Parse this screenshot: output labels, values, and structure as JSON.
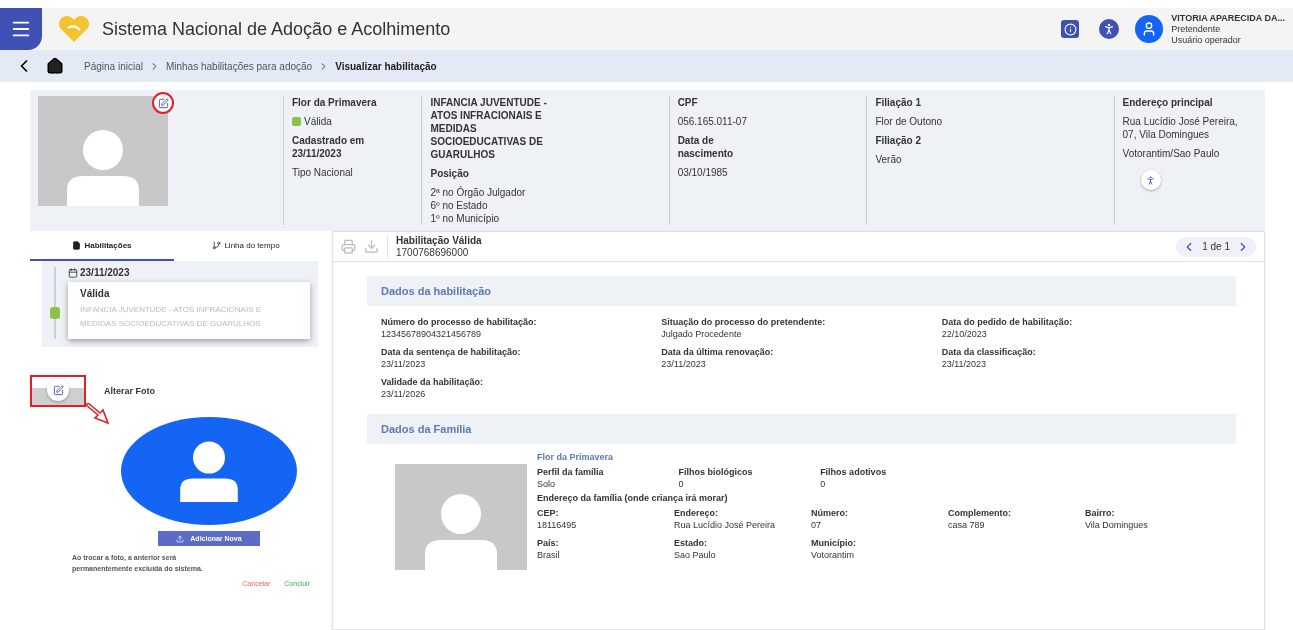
{
  "header": {
    "title": "Sistema Nacional de Adoção e Acolhimento",
    "user": {
      "name": "VITORIA APARECIDA DA...",
      "role": "Pretendente",
      "profile": "Usuário operador"
    }
  },
  "breadcrumb": [
    {
      "label": "Página inicial",
      "current": false
    },
    {
      "label": "Minhas habilitações para adoção",
      "current": false
    },
    {
      "label": "Visualizar habilitação",
      "current": true
    }
  ],
  "summary": {
    "name": "Flor da Primavera",
    "status": {
      "label": "Válida",
      "color": "#8bc34a"
    },
    "registered": "Cadastrado em 23/11/2023",
    "type": "Tipo Nacional",
    "court": "INFANCIA JUVENTUDE - ATOS INFRACIONAIS E MEDIDAS SOCIOEDUCATIVAS DE GUARULHOS",
    "position_label": "Posição",
    "positions": [
      "2ª no Órgão Julgador",
      "6º no Estado",
      "1º no Município"
    ],
    "columns": [
      {
        "items": [
          {
            "label": "CPF",
            "values": [
              "056.165.011-07"
            ]
          },
          {
            "label": "Data de nascimento",
            "values": [
              "03/10/1985"
            ]
          }
        ]
      },
      {
        "items": [
          {
            "label": "Filiação 1",
            "values": [
              "Flor de Outono"
            ]
          },
          {
            "label": "Filiação 2",
            "values": [
              "Verão"
            ]
          }
        ]
      },
      {
        "items": [
          {
            "label": "Endereço principal",
            "values": [
              "Rua Lucídio José Pereira, 07, Vila Domingues",
              "Votorantim/Sao Paulo"
            ]
          }
        ]
      }
    ]
  },
  "tabs": [
    {
      "label": "Habilitações",
      "selected": true
    },
    {
      "label": "Linha do tempo",
      "selected": false
    }
  ],
  "timeline": {
    "date": "23/11/2023",
    "status": "Válida",
    "color": "#8bc34a",
    "court": "INFANCIA JUVENTUDE - ATOS INFRACIONAIS E MEDIDAS SOCIOEDUCATIVAS DE GUARULHOS"
  },
  "photo_change": {
    "title": "Alterar Foto",
    "button": "Adicionar Nova",
    "note": "Ao trocar a foto, a anterior será permanentemente excluída do sistema.",
    "cancel": "Cancelar",
    "confirm": "Concluir"
  },
  "detail": {
    "title": "Habilitação Válida",
    "id": "1700768696000",
    "page": "1 de 1",
    "sections": [
      {
        "kind": "fields",
        "title": "Dados da habilitação",
        "fields": [
          {
            "label": "Número do processo de habilitação:",
            "value": "12345678904321456789"
          },
          {
            "label": "Situação do processo do pretendente:",
            "value": "Julgado Procedente"
          },
          {
            "label": "Data do pedido de habilitação:",
            "value": "22/10/2023"
          },
          {
            "label": "Data da sentença de habilitação:",
            "value": "23/11/2023"
          },
          {
            "label": "Data da última renovação:",
            "value": "23/11/2023"
          },
          {
            "label": "Data da classificação:",
            "value": "23/11/2023"
          },
          {
            "label": "Validade da habilitação:",
            "value": "23/11/2026"
          }
        ]
      },
      {
        "kind": "family",
        "title": "Dados da Família",
        "name": "Flor da Primavera",
        "fields": [
          {
            "label": "Perfil da família",
            "value": "Solo"
          },
          {
            "label": "Filhos biológicos",
            "value": "0"
          },
          {
            "label": "Filhos adotivos",
            "value": "0"
          }
        ],
        "address_title": "Endereço da família (onde criança irá morar)",
        "address": [
          {
            "label": "CEP:",
            "value": "18116495"
          },
          {
            "label": "Endereço:",
            "value": "Rua Lucídio José Pereira"
          },
          {
            "label": "Número:",
            "value": "07"
          },
          {
            "label": "Complemento:",
            "value": "casa 789"
          },
          {
            "label": "Bairro:",
            "value": "Vila Domingues"
          },
          {
            "label": "País:",
            "value": "Brasil"
          },
          {
            "label": "Estado:",
            "value": "Sao Paulo"
          },
          {
            "label": "Município:",
            "value": "Votorantim"
          }
        ]
      }
    ]
  }
}
